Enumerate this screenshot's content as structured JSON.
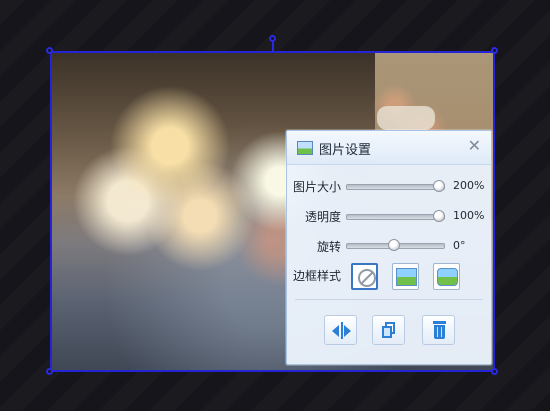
{
  "dialog": {
    "title": "图片设置",
    "close_icon": "close-icon",
    "rows": {
      "size": {
        "label": "图片大小",
        "value_text": "200%",
        "level": 1.0
      },
      "opacity": {
        "label": "透明度",
        "value_text": "100%",
        "level": 1.0
      },
      "rotate": {
        "label": "旋转",
        "value_text": "0°",
        "level": 0.5
      }
    },
    "border_style_label": "边框样式",
    "border_styles": [
      "none-icon",
      "picture-frame-square-icon",
      "picture-frame-rounded-icon"
    ],
    "actions": [
      "flip-horizontal-icon",
      "copy-icon",
      "delete-icon"
    ]
  },
  "colors": {
    "selection": "#2424d6",
    "accent": "#2b7fd6",
    "dialog_bg": "#ebf2fc"
  }
}
